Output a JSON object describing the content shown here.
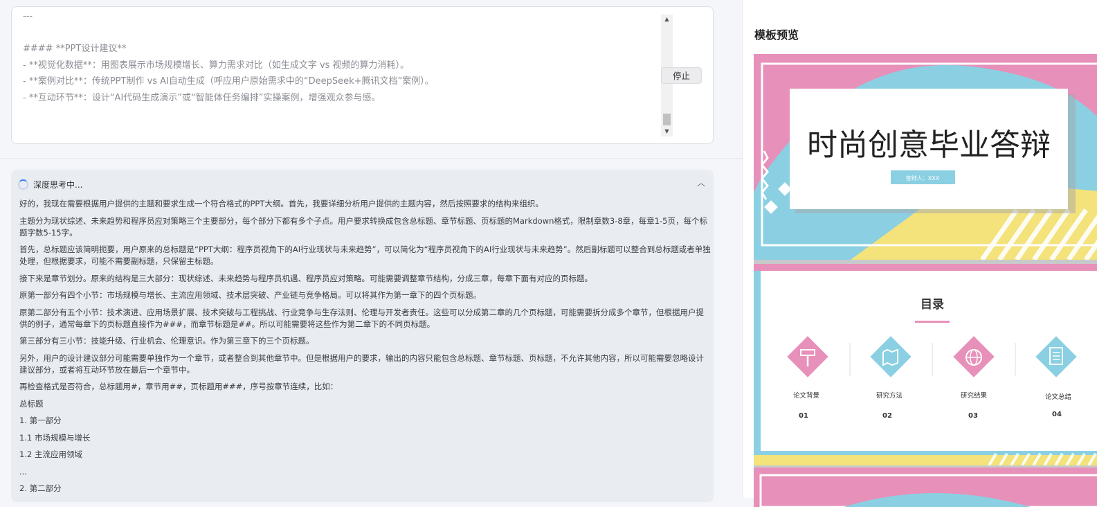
{
  "editor": {
    "lines": [
      "---",
      "",
      "#### **PPT设计建议**",
      "- **视觉化数据**：用图表展示市场规模增长、算力需求对比（如生成文字 vs 视频的算力消耗）。",
      "- **案例对比**：传统PPT制作 vs AI自动生成（呼应用户原始需求中的“DeepSeek+腾讯文档”案例）。",
      "- **互动环节**：设计“AI代码生成演示”或“智能体任务编排”实操案例，增强观众参与感。"
    ],
    "stop_button": "停止"
  },
  "thinking": {
    "status": "深度思考中...",
    "paragraphs": [
      "好的，我现在需要根据用户提供的主题和要求生成一个符合格式的PPT大纲。首先，我要详细分析用户提供的主题内容，然后按照要求的结构来组织。",
      "主题分为现状综述、未来趋势和程序员应对策略三个主要部分，每个部分下都有多个子点。用户要求转换成包含总标题、章节标题、页标题的Markdown格式，限制章数3-8章，每章1-5页，每个标题字数5-15字。",
      "首先，总标题应该简明扼要，用户原来的总标题是“PPT大纲：程序员视角下的AI行业现状与未来趋势”，可以简化为“程序员视角下的AI行业现状与未来趋势”。然后副标题可以整合到总标题或者单独处理，但根据要求，可能不需要副标题，只保留主标题。",
      "接下来是章节划分。原来的结构是三大部分：现状综述、未来趋势与程序员机遇、程序员应对策略。可能需要调整章节结构，分成三章，每章下面有对应的页标题。",
      "原第一部分有四个小节：市场规模与增长、主流应用领域、技术层突破、产业链与竞争格局。可以将其作为第一章下的四个页标题。",
      "原第二部分有五个小节：技术演进、应用场景扩展、技术突破与工程挑战、行业竞争与生存法则、伦理与开发者责任。这些可以分成第二章的几个页标题，可能需要拆分成多个章节，但根据用户提供的例子，通常每章下的页标题直接作为###，而章节标题是##。所以可能需要将这些作为第二章下的不同页标题。",
      "第三部分有三小节：技能升级、行业机会、伦理意识。作为第三章下的三个页标题。",
      "另外，用户的设计建议部分可能需要单独作为一个章节，或者整合到其他章节中。但是根据用户的要求，输出的内容只能包含总标题、章节标题、页标题，不允许其他内容，所以可能需要忽略设计建议部分，或者将互动环节放在最后一个章节中。",
      "再检查格式是否符合，总标题用#，章节用##，页标题用###，序号按章节连续，比如：",
      "总标题",
      "1. 第一部分",
      "1.1 市场规模与增长",
      "1.2 主流应用领域",
      "...",
      "2. 第二部分"
    ]
  },
  "preview": {
    "title": "模板预览",
    "slide1": {
      "title": "时尚创意毕业答辩",
      "presenter": "答辩人：XXX"
    },
    "slide2": {
      "title": "目录",
      "items": [
        {
          "label": "论文背景",
          "num": "01",
          "icon": "signpost-icon"
        },
        {
          "label": "研究方法",
          "num": "02",
          "icon": "map-icon"
        },
        {
          "label": "研究结果",
          "num": "03",
          "icon": "globe-icon"
        },
        {
          "label": "论文总结",
          "num": "04",
          "icon": "document-icon"
        }
      ]
    },
    "colors": {
      "pink": "#e790b9",
      "blue": "#8ad0e2",
      "yellow": "#f4e27a",
      "gray": "#c7c9cb"
    }
  }
}
